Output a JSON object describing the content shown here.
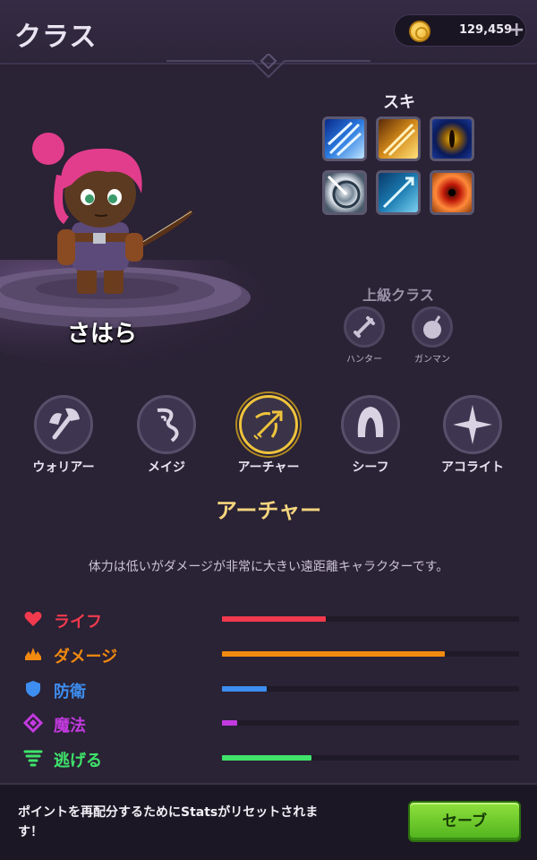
{
  "header": {
    "title": "クラス",
    "coins": "129,459",
    "add_icon": "+"
  },
  "hero": {
    "name": "さはら"
  },
  "skills": {
    "label": "スキル",
    "items": [
      {
        "icon": "multi-shot-icon"
      },
      {
        "icon": "fire-arrow-icon"
      },
      {
        "icon": "eagle-eye-icon"
      },
      {
        "icon": "target-shot-icon"
      },
      {
        "icon": "ice-arrow-icon"
      },
      {
        "icon": "crimson-eye-icon"
      }
    ]
  },
  "advanced": {
    "label": "上級クラス",
    "items": [
      {
        "label": "ハンター",
        "icon": "dagger-icon"
      },
      {
        "label": "ガンマン",
        "icon": "bomb-icon"
      }
    ]
  },
  "classes": [
    {
      "label": "ウォリアー",
      "icon": "axe-icon",
      "selected": false
    },
    {
      "label": "メイジ",
      "icon": "magic-swirl-icon",
      "selected": false
    },
    {
      "label": "アーチャー",
      "icon": "bow-icon",
      "selected": true
    },
    {
      "label": "シーフ",
      "icon": "hood-icon",
      "selected": false
    },
    {
      "label": "アコライト",
      "icon": "holy-cross-icon",
      "selected": false
    }
  ],
  "selected_class": {
    "title": "アーチャー",
    "description": "体力は低いがダメージが非常に大きい遠距離キャラクターです。"
  },
  "stats": [
    {
      "label": "ライフ",
      "icon": "heart-icon",
      "color": "#f23a4e",
      "value": 0.35
    },
    {
      "label": "ダメージ",
      "icon": "flame-icon",
      "color": "#f28a10",
      "value": 0.75
    },
    {
      "label": "防衛",
      "icon": "shield-icon",
      "color": "#3d8ef0",
      "value": 0.15
    },
    {
      "label": "魔法",
      "icon": "diamond-icon",
      "color": "#c33ae0",
      "value": 0.05
    },
    {
      "label": "逃げる",
      "icon": "tornado-icon",
      "color": "#3fe36a",
      "value": 0.3
    }
  ],
  "footer": {
    "message": "ポイントを再配分するためにStatsがリセットされます！",
    "save_label": "セーブ"
  }
}
